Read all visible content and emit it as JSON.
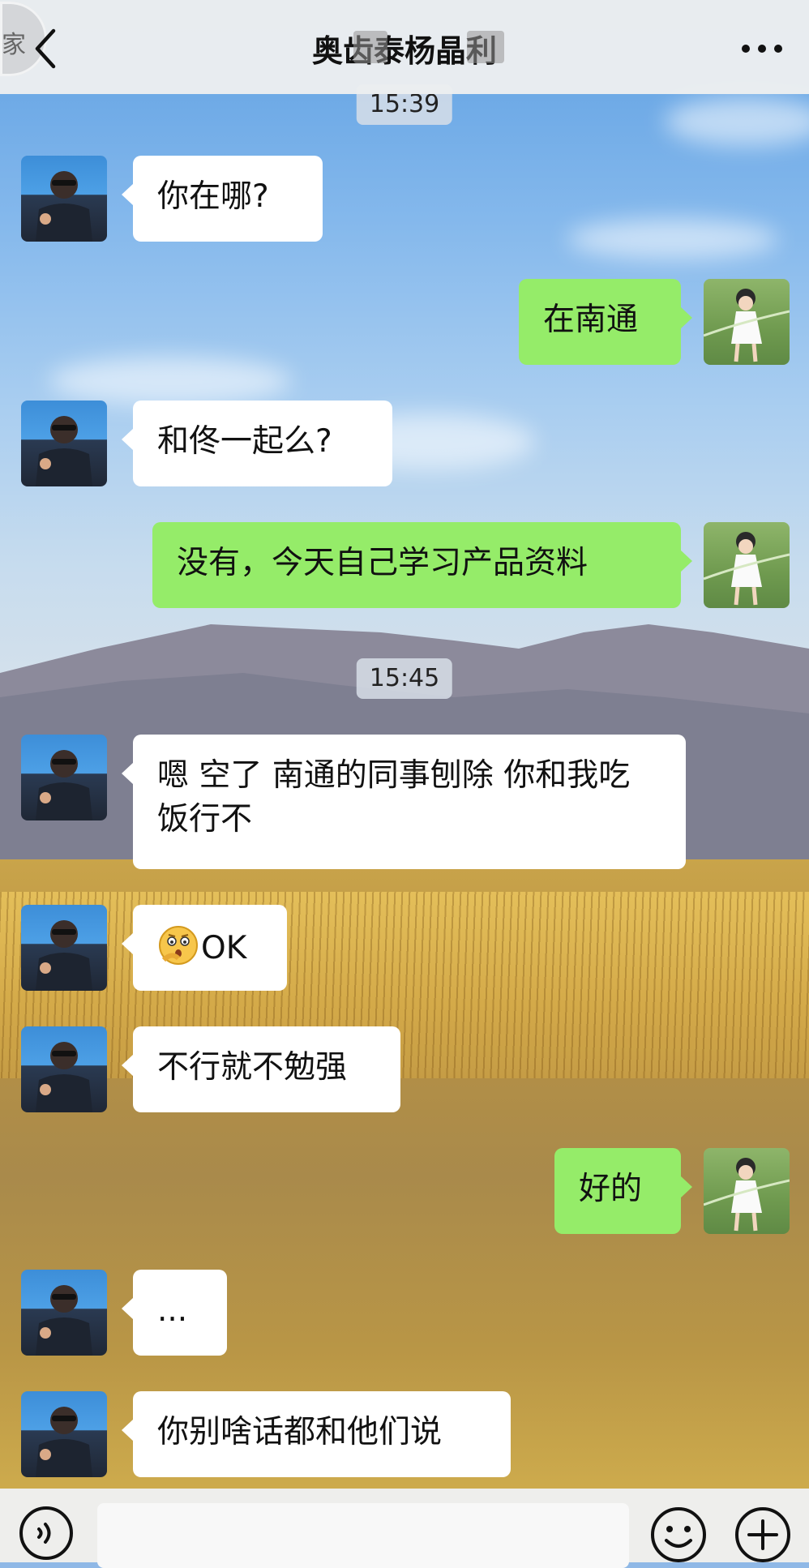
{
  "header": {
    "title": "奥齿泰杨晶利",
    "back_icon": "chevron-left-icon",
    "more_icon": "more-dots-icon",
    "floating_badge": "家"
  },
  "colors": {
    "bubble_incoming": "#ffffff",
    "bubble_outgoing": "#95ec69",
    "topbar": "#eceef0"
  },
  "timestamps": [
    "15:39",
    "15:45"
  ],
  "messages": [
    {
      "from": "contact",
      "text": "你在哪?"
    },
    {
      "from": "me",
      "text": "在南通"
    },
    {
      "from": "contact",
      "text": "和佟一起么?"
    },
    {
      "from": "me",
      "text": "没有，今天自己学习产品资料"
    },
    {
      "from": "contact",
      "text": "嗯 空了 南通的同事刨除 你和我吃饭行不"
    },
    {
      "from": "contact",
      "text": "OK",
      "emoji": "thinking-face-icon"
    },
    {
      "from": "contact",
      "text": "不行就不勉强"
    },
    {
      "from": "me",
      "text": "好的"
    },
    {
      "from": "contact",
      "text": "..."
    },
    {
      "from": "contact",
      "text": "你别啥话都和他们说"
    }
  ],
  "input_bar": {
    "placeholder": "",
    "voice_icon": "voice-icon",
    "emoji_icon": "emoji-icon",
    "plus_icon": "plus-icon"
  }
}
